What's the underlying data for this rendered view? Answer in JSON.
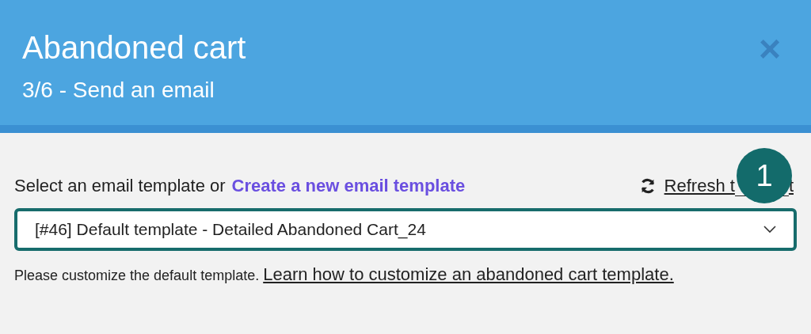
{
  "dialog": {
    "title": "Abandoned cart",
    "subtitle": "3/6 - Send an email",
    "close": "×"
  },
  "template": {
    "label": "Select an email template or",
    "create_link": "Create a new email template",
    "refresh_parts": [
      "Refresh t",
      "t"
    ],
    "value": "[#46] Default template - Detailed Abandoned Cart_24"
  },
  "help": {
    "text": "Please customize the default template.",
    "link": "Learn how to customize an abandoned cart template."
  },
  "step_badge": "1"
}
